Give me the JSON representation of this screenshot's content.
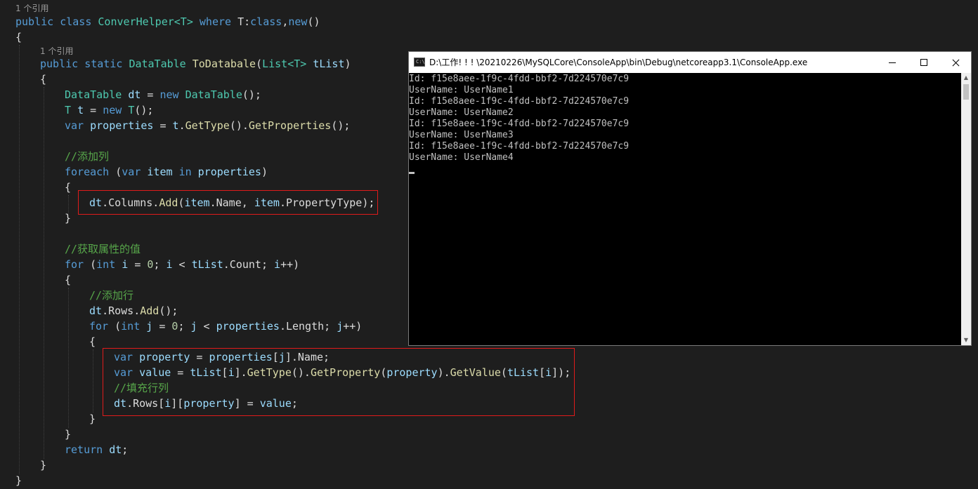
{
  "editor": {
    "lens": {
      "class_refs": "1 个引用",
      "method_refs": "1 个引用"
    },
    "code": {
      "l01": {
        "a": "public",
        "b": " ",
        "c": "class",
        "d": " ",
        "e": "ConverHelper<T>",
        "f": " ",
        "g": "where",
        "h": " T:",
        "i": "class",
        "j": ",",
        "k": "new",
        "l": "()"
      },
      "l02": {
        "a": "{"
      },
      "l03": {
        "a": "public",
        "b": " ",
        "c": "static",
        "d": " ",
        "e": "DataTable",
        "f": " ",
        "g": "ToDatabale",
        "h": "(",
        "i": "List<T>",
        "j": " ",
        "k": "tList",
        "l": ")"
      },
      "l04": {
        "a": "{"
      },
      "l05": {
        "a": "DataTable",
        "b": " ",
        "c": "dt",
        "d": " = ",
        "e": "new",
        "f": " ",
        "g": "DataTable",
        "h": "();"
      },
      "l06": {
        "a": "T",
        "b": " ",
        "c": "t",
        "d": " = ",
        "e": "new",
        "f": " ",
        "g": "T",
        "h": "();"
      },
      "l07": {
        "a": "var",
        "b": " ",
        "c": "properties",
        "d": " = ",
        "e": "t",
        "f": ".",
        "g": "GetType",
        "h": "().",
        "i": "GetProperties",
        "j": "();"
      },
      "l08": {
        "a": "//添加列"
      },
      "l09": {
        "a": "foreach",
        "b": " (",
        "c": "var",
        "d": " ",
        "e": "item",
        "f": " ",
        "g": "in",
        "h": " ",
        "i": "properties",
        "j": ")"
      },
      "l10": {
        "a": "{"
      },
      "l11": {
        "a": "dt",
        "b": ".Columns.",
        "c": "Add",
        "d": "(",
        "e": "item",
        "f": ".Name, ",
        "g": "item",
        "h": ".PropertyType);"
      },
      "l12": {
        "a": "}"
      },
      "l13": {
        "a": "//获取属性的值"
      },
      "l14": {
        "a": "for",
        "b": " (",
        "c": "int",
        "d": " ",
        "e": "i",
        "f": " = ",
        "g": "0",
        "h": "; ",
        "i": "i",
        "j": " < ",
        "k": "tList",
        "l": ".Count; ",
        "m": "i",
        "n": "++)"
      },
      "l15": {
        "a": "{"
      },
      "l16": {
        "a": "//添加行"
      },
      "l17": {
        "a": "dt",
        "b": ".Rows.",
        "c": "Add",
        "d": "();"
      },
      "l18": {
        "a": "for",
        "b": " (",
        "c": "int",
        "d": " ",
        "e": "j",
        "f": " = ",
        "g": "0",
        "h": "; ",
        "i": "j",
        "j": " < ",
        "k": "properties",
        "l": ".Length; ",
        "m": "j",
        "n": "++)"
      },
      "l19": {
        "a": "{"
      },
      "l20": {
        "a": "var",
        "b": " ",
        "c": "property",
        "d": " = ",
        "e": "properties",
        "f": "[",
        "g": "j",
        "h": "].Name;"
      },
      "l21": {
        "a": "var",
        "b": " ",
        "c": "value",
        "d": " = ",
        "e": "tList",
        "f": "[",
        "g": "i",
        "h": "].",
        "i": "GetType",
        "j": "().",
        "k": "GetProperty",
        "l": "(",
        "m": "property",
        "n": ").",
        "o": "GetValue",
        "p": "(",
        "q": "tList",
        "r": "[",
        "s": "i",
        "t": "]);"
      },
      "l22": {
        "a": "//填充行列"
      },
      "l23": {
        "a": "dt",
        "b": ".Rows[",
        "c": "i",
        "d": "][",
        "e": "property",
        "f": "] = ",
        "g": "value",
        "h": ";"
      },
      "l24": {
        "a": "}"
      },
      "l25": {
        "a": "}"
      },
      "l26": {
        "a": "return",
        "b": " ",
        "c": "dt",
        "d": ";"
      },
      "l27": {
        "a": "}"
      },
      "l28": {
        "a": "}"
      }
    },
    "highlight_color": "#e01b1b"
  },
  "console": {
    "icon_label": "C:\\",
    "title": "D:\\工作! ! ! \\20210226\\MySQLCore\\ConsoleApp\\bin\\Debug\\netcoreapp3.1\\ConsoleApp.exe",
    "buttons": {
      "minimize": "minimize-icon",
      "maximize": "maximize-icon",
      "close": "close-icon"
    },
    "lines": [
      "Id: f15e8aee-1f9c-4fdd-bbf2-7d224570e7c9",
      "UserName: UserName1",
      "Id: f15e8aee-1f9c-4fdd-bbf2-7d224570e7c9",
      "UserName: UserName2",
      "Id: f15e8aee-1f9c-4fdd-bbf2-7d224570e7c9",
      "UserName: UserName3",
      "Id: f15e8aee-1f9c-4fdd-bbf2-7d224570e7c9",
      "UserName: UserName4"
    ],
    "scroll_up": "▲",
    "scroll_down": "▼"
  }
}
